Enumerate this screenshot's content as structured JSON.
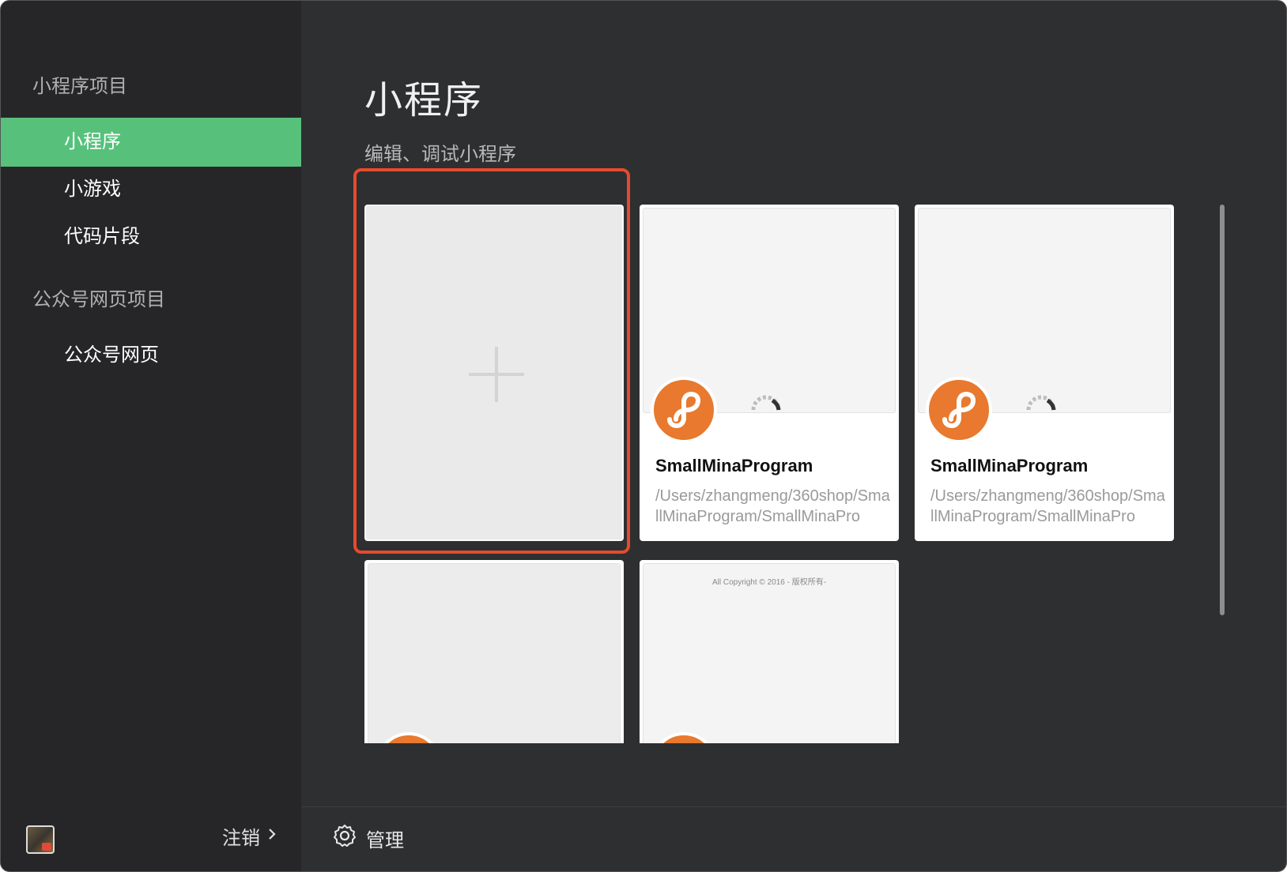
{
  "sidebar": {
    "sections": [
      {
        "title": "小程序项目",
        "items": [
          "小程序",
          "小游戏",
          "代码片段"
        ]
      },
      {
        "title": "公众号网页项目",
        "items": [
          "公众号网页"
        ]
      }
    ],
    "active_item": "小程序",
    "logout_label": "注销"
  },
  "main": {
    "title": "小程序",
    "subtitle": "编辑、调试小程序",
    "projects": [
      {
        "name": "SmallMinaProgram",
        "path": "/Users/zhangmeng/360shop/SmallMinaProgram/SmallMinaPro"
      },
      {
        "name": "SmallMinaProgram",
        "path": "/Users/zhangmeng/360shop/SmallMinaProgram/SmallMinaPro"
      }
    ],
    "copyright_text": "All Copyright © 2016 - 版权所有-"
  },
  "footer": {
    "manage_label": "管理"
  },
  "colors": {
    "accent_green": "#57c17b",
    "highlight_red": "#e64a2e",
    "logo_orange": "#e8792e"
  },
  "icons": [
    "plus-icon",
    "miniprogram-logo-icon",
    "loading-spinner-icon",
    "gear-icon",
    "chevron-right-icon"
  ]
}
